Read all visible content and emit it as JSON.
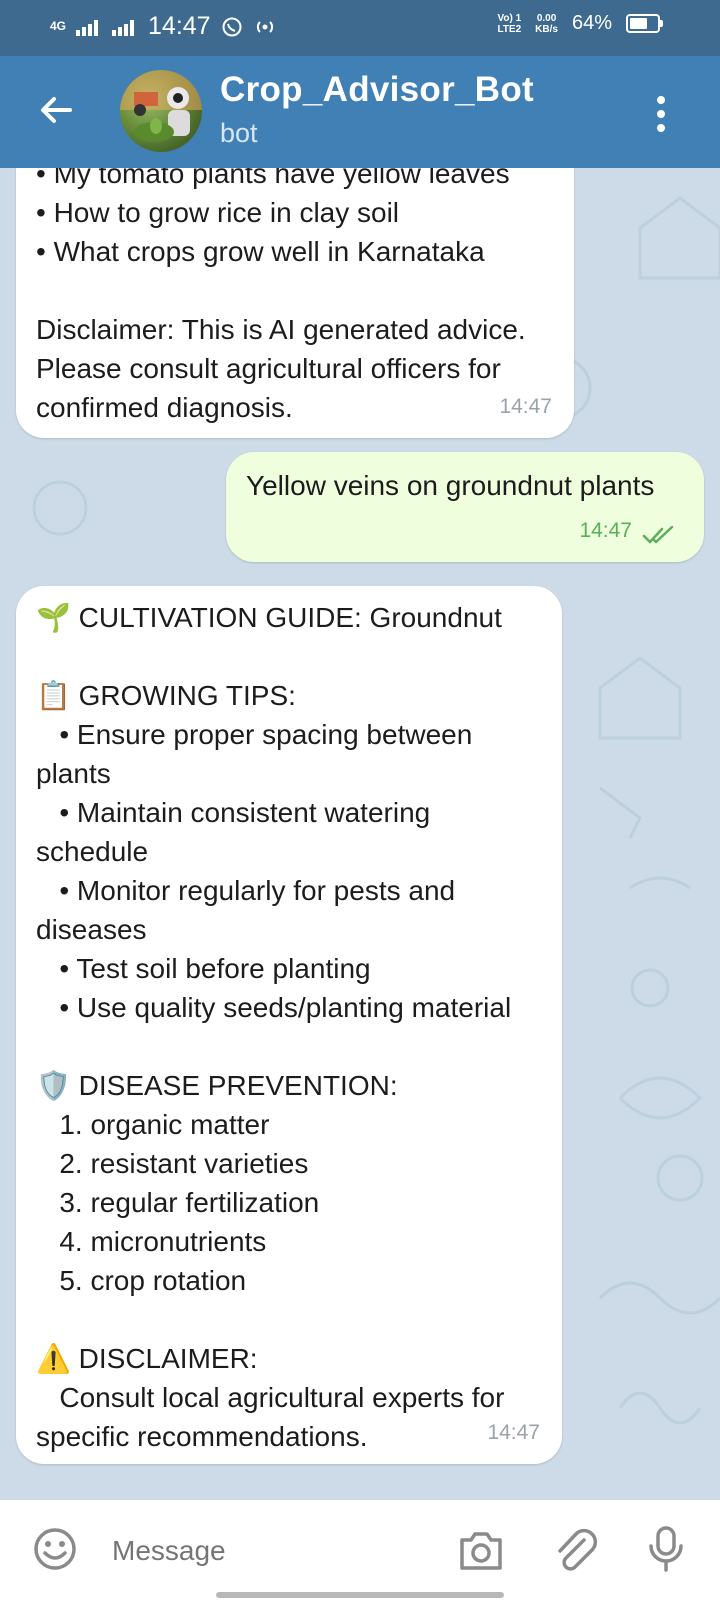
{
  "status_bar": {
    "network": "4G",
    "time": "14:47",
    "volte": "Vo) 1\nLTE2",
    "speed": "0.00\nKB/s",
    "battery": "64%",
    "battery_level": 0.64
  },
  "header": {
    "title": "Crop_Advisor_Bot",
    "subtitle": "bot"
  },
  "messages": [
    {
      "direction": "incoming",
      "text": "• My tomato plants have yellow leaves\n• How to grow rice in clay soil\n• What crops grow well in Karnataka\n\nDisclaimer: This is AI generated advice.\nPlease consult agricultural officers for\nconfirmed diagnosis.",
      "time": "14:47"
    },
    {
      "direction": "outgoing",
      "text": "Yellow veins on groundnut plants",
      "time": "14:47",
      "status": "read"
    },
    {
      "direction": "incoming",
      "text": "🌱 CULTIVATION GUIDE: Groundnut\n\n📋 GROWING TIPS:\n   • Ensure proper spacing between\nplants\n   • Maintain consistent watering\nschedule\n   • Monitor regularly for pests and\ndiseases\n   • Test soil before planting\n   • Use quality seeds/planting material\n\n🛡️ DISEASE PREVENTION:\n   1. organic matter\n   2. resistant varieties\n   3. regular fertilization\n   4. micronutrients\n   5. crop rotation\n\n⚠️ DISCLAIMER:\n   Consult local agricultural experts for\nspecific recommendations.",
      "time": "14:47"
    }
  ],
  "input": {
    "placeholder": "Message"
  },
  "icons": {
    "back": "arrow-left-icon",
    "menu": "more-vert-icon",
    "emoji": "emoji-icon",
    "camera": "camera-icon",
    "attach": "paperclip-icon",
    "mic": "microphone-icon"
  },
  "colors": {
    "status_bar": "#3e6a8f",
    "app_bar": "#4180b5",
    "chat_bg": "#ccdbe7",
    "incoming_bubble": "#ffffff",
    "outgoing_bubble": "#effedd",
    "read_check": "#5aaf5b"
  }
}
